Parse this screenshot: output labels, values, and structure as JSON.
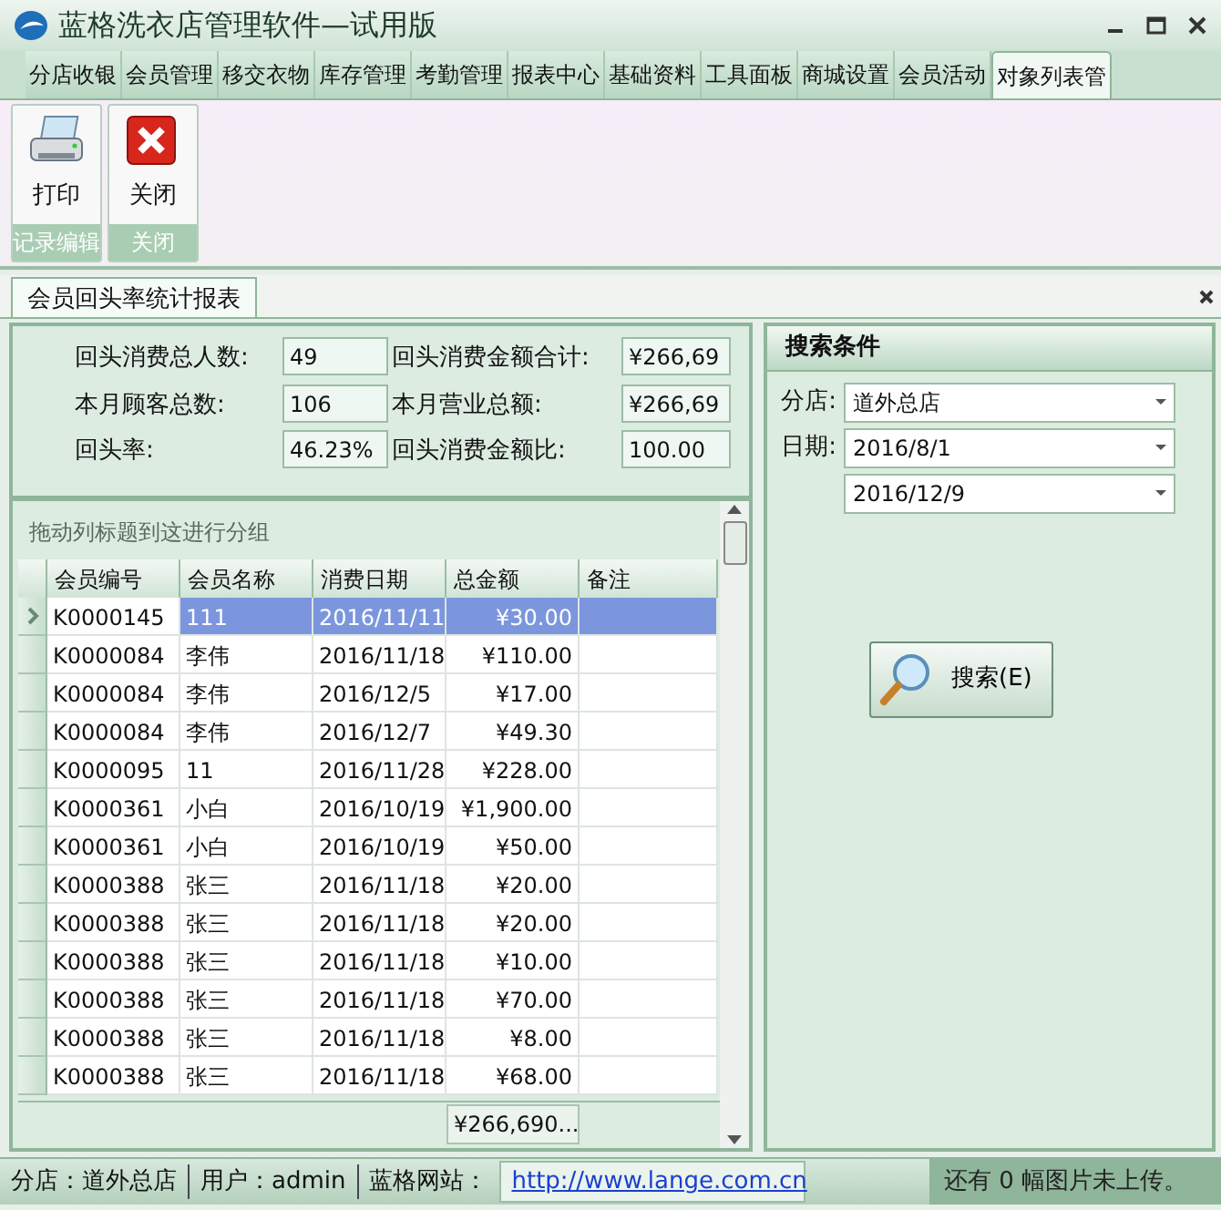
{
  "window": {
    "title": "蓝格洗衣店管理软件—试用版"
  },
  "menu_tabs": [
    {
      "label": "分店收银",
      "selected": false
    },
    {
      "label": "会员管理",
      "selected": false
    },
    {
      "label": "移交衣物",
      "selected": false
    },
    {
      "label": "库存管理",
      "selected": false
    },
    {
      "label": "考勤管理",
      "selected": false
    },
    {
      "label": "报表中心",
      "selected": false
    },
    {
      "label": "基础资料",
      "selected": false
    },
    {
      "label": "工具面板",
      "selected": false
    },
    {
      "label": "商城设置",
      "selected": false
    },
    {
      "label": "会员活动",
      "selected": false
    },
    {
      "label": "对象列表管",
      "selected": true
    }
  ],
  "toolbar": {
    "groups": [
      {
        "label": "记录编辑",
        "buttons": [
          {
            "label": "打印",
            "kind": "print"
          }
        ]
      },
      {
        "label": "关闭",
        "buttons": [
          {
            "label": "关闭",
            "kind": "close"
          }
        ]
      }
    ]
  },
  "document_tabs": [
    {
      "label": "会员回头率统计报表",
      "selected": true
    }
  ],
  "stats": [
    {
      "label": "回头消费总人数:",
      "value": "49"
    },
    {
      "label": "回头消费金额合计:",
      "value": "¥266,69"
    },
    {
      "label": "本月顾客总数:",
      "value": "106"
    },
    {
      "label": "本月营业总额:",
      "value": "¥266,69"
    },
    {
      "label": "回头率:",
      "value": "46.23%"
    },
    {
      "label": "回头消费金额比:",
      "value": "100.00"
    }
  ],
  "grid": {
    "group_hint": "拖动列标题到这进行分组",
    "columns": [
      "会员编号",
      "会员名称",
      "消费日期",
      "总金额",
      "备注"
    ],
    "rows": [
      {
        "cells": [
          "K0000145",
          "111",
          "2016/11/11",
          "¥30.00",
          ""
        ],
        "selected": true
      },
      {
        "cells": [
          "K0000084",
          "李伟",
          "2016/11/18",
          "¥110.00",
          ""
        ],
        "selected": false
      },
      {
        "cells": [
          "K0000084",
          "李伟",
          "2016/12/5",
          "¥17.00",
          ""
        ],
        "selected": false
      },
      {
        "cells": [
          "K0000084",
          "李伟",
          "2016/12/7",
          "¥49.30",
          ""
        ],
        "selected": false
      },
      {
        "cells": [
          "K0000095",
          "11",
          "2016/11/28",
          "¥228.00",
          ""
        ],
        "selected": false
      },
      {
        "cells": [
          "K0000361",
          "小白",
          "2016/10/19",
          "¥1,900.00",
          ""
        ],
        "selected": false
      },
      {
        "cells": [
          "K0000361",
          "小白",
          "2016/10/19",
          "¥50.00",
          ""
        ],
        "selected": false
      },
      {
        "cells": [
          "K0000388",
          "张三",
          "2016/11/18",
          "¥20.00",
          ""
        ],
        "selected": false
      },
      {
        "cells": [
          "K0000388",
          "张三",
          "2016/11/18",
          "¥20.00",
          ""
        ],
        "selected": false
      },
      {
        "cells": [
          "K0000388",
          "张三",
          "2016/11/18",
          "¥10.00",
          ""
        ],
        "selected": false
      },
      {
        "cells": [
          "K0000388",
          "张三",
          "2016/11/18",
          "¥70.00",
          ""
        ],
        "selected": false
      },
      {
        "cells": [
          "K0000388",
          "张三",
          "2016/11/18",
          "¥8.00",
          ""
        ],
        "selected": false
      },
      {
        "cells": [
          "K0000388",
          "张三",
          "2016/11/18",
          "¥68.00",
          ""
        ],
        "selected": false
      }
    ],
    "total": "¥266,690..."
  },
  "search": {
    "title": "搜索条件",
    "fields": [
      {
        "label": "分店:",
        "value": "道外总店"
      },
      {
        "label": "日期:",
        "value": "2016/8/1"
      },
      {
        "value": "2016/12/9"
      }
    ],
    "button": "搜索(E)"
  },
  "status_bar": {
    "items": [
      "分店：道外总店",
      "用户：admin",
      "蓝格网站："
    ],
    "url": "http://www.lange.com.cn",
    "message": "还有 0 幅图片未上传。"
  }
}
